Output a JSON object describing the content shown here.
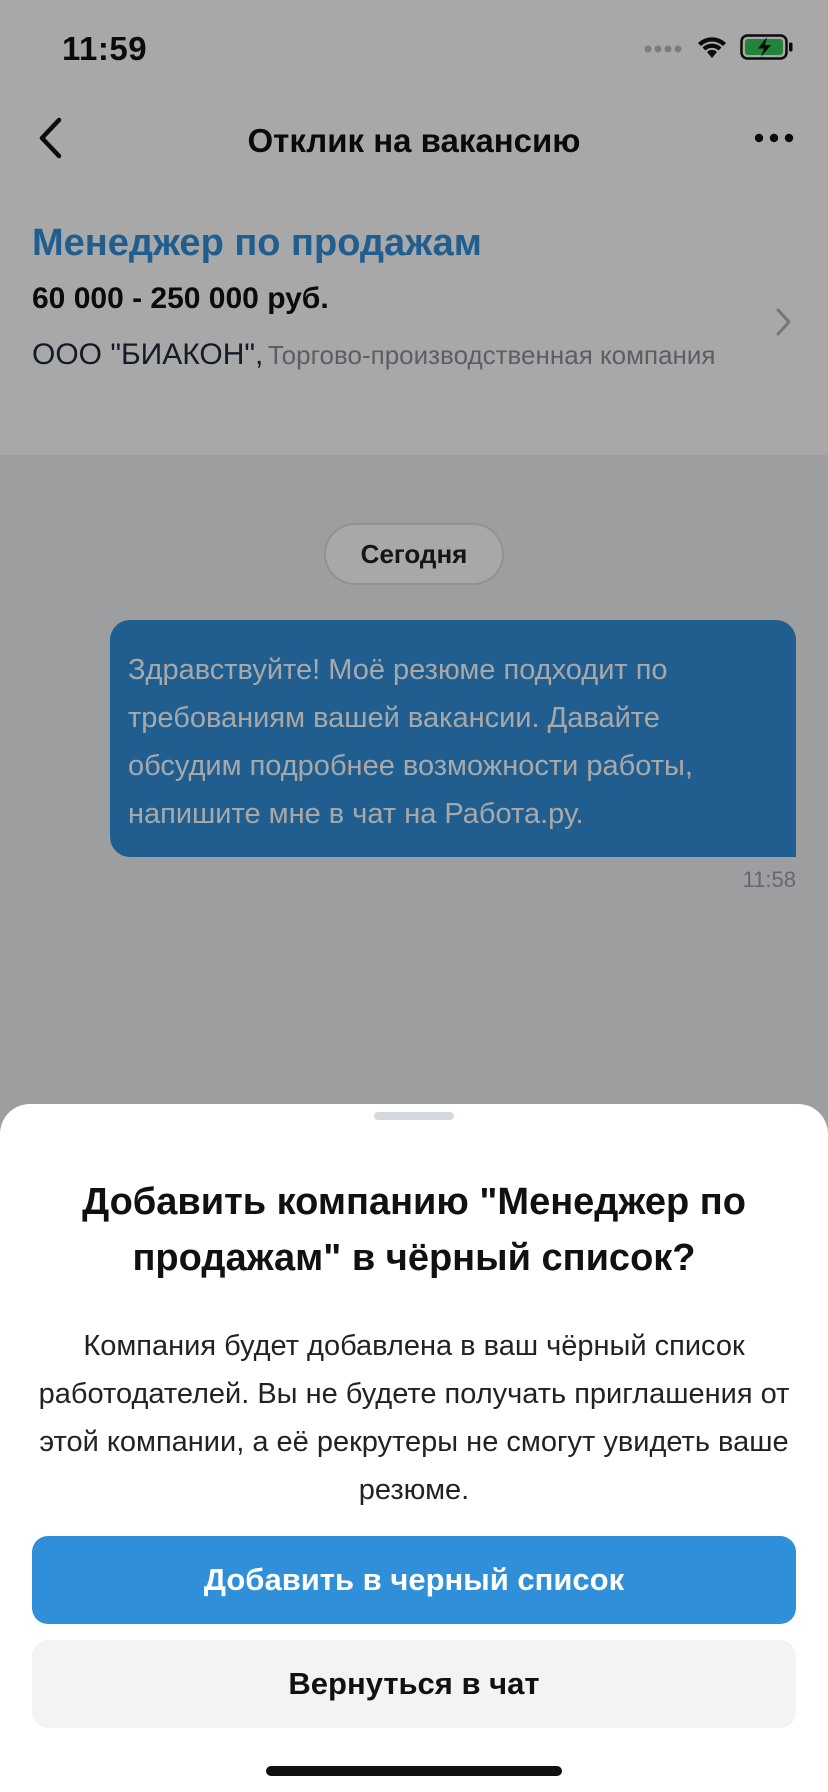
{
  "status_bar": {
    "time": "11:59"
  },
  "nav": {
    "title": "Отклик на вакансию"
  },
  "vacancy": {
    "title": "Менеджер по продажам",
    "salary": "60 000 - 250 000 руб.",
    "company_name": "ООО \"БИАКОН\",",
    "company_description": "Торгово-производственная компания"
  },
  "chat": {
    "date_label": "Сегодня",
    "messages": [
      {
        "text": "Здравствуйте! Моё резюме подходит по требованиям вашей вакансии. Давайте обсудим подробнее возможности работы, напишите мне в чат на Работа.ру.",
        "time": "11:58"
      }
    ]
  },
  "sheet": {
    "title": "Добавить компанию \"Менеджер по продажам\" в чёрный список?",
    "description": "Компания будет добавлена в ваш чёрный список работодателей. Вы не будете получать приглашения от этой компании, а её рекрутеры не смогут увидеть ваше резюме.",
    "primary_button": "Добавить в черный список",
    "secondary_button": "Вернуться в чат"
  },
  "colors": {
    "accent": "#2f8fd9",
    "overlay": "rgba(0,0,0,0.34)",
    "battery_fill": "#34c759"
  },
  "icons": {
    "back": "chevron-left-icon",
    "more": "more-horizontal-icon",
    "vacancy_open": "chevron-right-icon",
    "signal": "cellular-signal-icon",
    "wifi": "wifi-icon",
    "battery": "battery-charging-icon"
  }
}
